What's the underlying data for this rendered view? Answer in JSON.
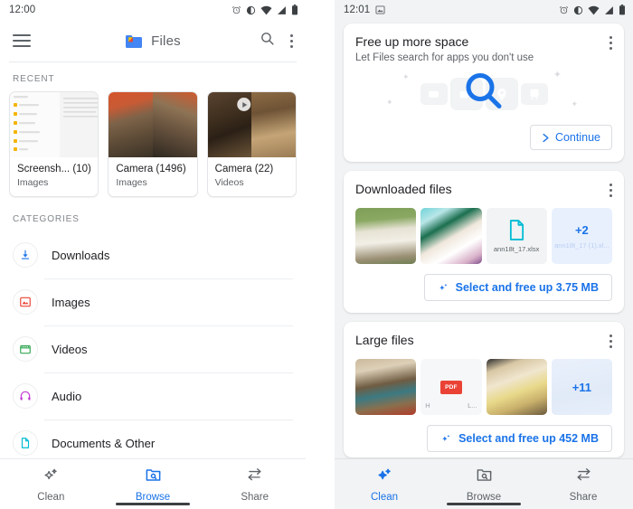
{
  "left_phone": {
    "status_bar": {
      "time": "12:00",
      "icons": [
        "alarm-icon",
        "dnd-icon",
        "wifi-icon",
        "signal-icon",
        "battery-icon"
      ]
    },
    "app_bar": {
      "menu_icon": "hamburger-menu-icon",
      "logo_icon": "files-logo-icon",
      "title": "Files",
      "search_icon": "search-icon",
      "overflow_icon": "more-vert-icon"
    },
    "recent": {
      "label": "RECENT",
      "cards": [
        {
          "title": "Screensh...  (10)",
          "subtitle": "Images",
          "kind": "document-thumb",
          "has_play": false
        },
        {
          "title": "Camera (1496)",
          "subtitle": "Images",
          "kind": "photo-thumb",
          "has_play": false
        },
        {
          "title": "Camera (22)",
          "subtitle": "Videos",
          "kind": "video-thumb",
          "has_play": true
        }
      ]
    },
    "categories": {
      "label": "CATEGORIES",
      "items": [
        {
          "label": "Downloads",
          "icon": "download-icon",
          "color": "#1a73e8"
        },
        {
          "label": "Images",
          "icon": "image-icon",
          "color": "#ea4335"
        },
        {
          "label": "Videos",
          "icon": "video-icon",
          "color": "#34a853"
        },
        {
          "label": "Audio",
          "icon": "headphones-icon",
          "color": "#c239d4"
        },
        {
          "label": "Documents & Other",
          "icon": "document-icon",
          "color": "#00bcd4"
        }
      ]
    },
    "bottom_nav": {
      "items": [
        {
          "label": "Clean",
          "icon": "sparkle-icon",
          "active": false
        },
        {
          "label": "Browse",
          "icon": "browse-folder-search-icon",
          "active": true
        },
        {
          "label": "Share",
          "icon": "share-arrows-icon",
          "active": false
        }
      ]
    }
  },
  "right_phone": {
    "status_bar": {
      "time": "12:01",
      "notification_icon": "screenshot-image-icon",
      "icons": [
        "alarm-icon",
        "dnd-icon",
        "wifi-icon",
        "signal-icon",
        "battery-icon"
      ]
    },
    "cards": [
      {
        "title": "Free up more space",
        "subtitle": "Let Files search for apps you don't use",
        "overflow_icon": "more-vert-icon",
        "illustration_icon": "magnifier-apps-icon",
        "button_label": "Continue",
        "button_icon": "chevron-right-icon"
      },
      {
        "title": "Downloaded files",
        "overflow_icon": "more-vert-icon",
        "tiles": [
          {
            "kind": "photo",
            "label": ""
          },
          {
            "kind": "photo",
            "label": ""
          },
          {
            "kind": "doc",
            "label": "ann18t_17.xlsx",
            "icon": "file-doc-icon"
          },
          {
            "kind": "doc-more",
            "label": "ann18t_17 (1).xl...",
            "badge": "+2"
          }
        ],
        "cta_label": "Select and free up 3.75 MB",
        "cta_icon": "sparkle-icon"
      },
      {
        "title": "Large files",
        "overflow_icon": "more-vert-icon",
        "tiles": [
          {
            "kind": "photo",
            "label": ""
          },
          {
            "kind": "pdf",
            "badge": "PDF",
            "corner_left": "H",
            "corner_right": "L..."
          },
          {
            "kind": "photo",
            "label": ""
          },
          {
            "kind": "photo-more",
            "badge": "+11"
          }
        ],
        "cta_label": "Select and free up 452 MB",
        "cta_icon": "sparkle-icon"
      }
    ],
    "bottom_nav": {
      "items": [
        {
          "label": "Clean",
          "icon": "sparkle-icon",
          "active": true
        },
        {
          "label": "Browse",
          "icon": "browse-folder-search-icon",
          "active": false
        },
        {
          "label": "Share",
          "icon": "share-arrows-icon",
          "active": false
        }
      ]
    }
  },
  "colors": {
    "accent": "#1a73e8",
    "text_primary": "#202124",
    "text_secondary": "#5f6368",
    "surface": "#ffffff",
    "background": "#f1f3f4"
  }
}
